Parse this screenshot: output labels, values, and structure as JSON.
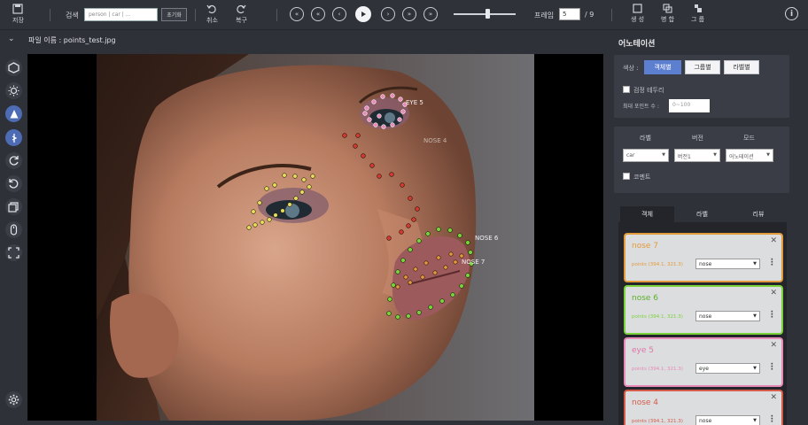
{
  "toolbar": {
    "save_label": "저장",
    "search_label": "검색",
    "search_placeholder": "person | car | ...",
    "reset_label": "초기화",
    "undo_label": "취소",
    "redo_label": "복구",
    "nav_glyphs": {
      "first": "«",
      "prev10": "«",
      "prev": "‹",
      "next": "›",
      "next10": "»",
      "last": "»"
    },
    "frame_label": "프레임",
    "frame_current": "5",
    "frame_total": "/ 9",
    "frame_slider": 0.52,
    "create_label": "생 성",
    "merge_label": "병 합",
    "group_label": "그 룹",
    "info_glyph": "i"
  },
  "file": {
    "chevron": "⌄",
    "name": "파일 이름 : points_test.jpg"
  },
  "left_tools": [
    "polygon-tool-icon",
    "brightness-icon",
    "contrast-icon",
    "saturation-icon",
    "rotate-cw-icon",
    "rotate-ccw-icon",
    "layers-icon",
    "mouse-icon",
    "fit-screen-icon",
    "settings-icon"
  ],
  "canvas": {
    "labels": [
      {
        "text": "EYE 5"
      },
      {
        "text": "NOSE 4"
      },
      {
        "text": "NOSE 6"
      },
      {
        "text": "NOSE 7"
      }
    ]
  },
  "annotation": {
    "title": "어노테이션",
    "color_label": "색상 :",
    "color_options": [
      "객체별",
      "그룹별",
      "라벨별"
    ],
    "border_label": "검정 테두리",
    "max_points_label": "최대 포인트 수 :",
    "max_points_placeholder": "0~100",
    "label_header": "라벨",
    "version_header": "버전",
    "mode_header": "모드",
    "label_value": "car",
    "version_value": "버전1",
    "mode_value": "어노테이션",
    "comment_label": "코멘트",
    "tabs": [
      "객체",
      "라벨",
      "리뷰"
    ],
    "objects": [
      {
        "name": "nose 7",
        "points": "points (394.1, 321.3)",
        "label": "nose",
        "color": "#e39a3a"
      },
      {
        "name": "nose 6",
        "points": "points (394.1, 321.3)",
        "label": "nose",
        "color": "#7ad23a"
      },
      {
        "name": "eye 5",
        "points": "points (394.1, 321.3)",
        "label": "eye",
        "color": "#e88ab8"
      },
      {
        "name": "nose 4",
        "points": "points (394.1, 321.3)",
        "label": "nose",
        "color": "#d65a4a"
      }
    ]
  }
}
